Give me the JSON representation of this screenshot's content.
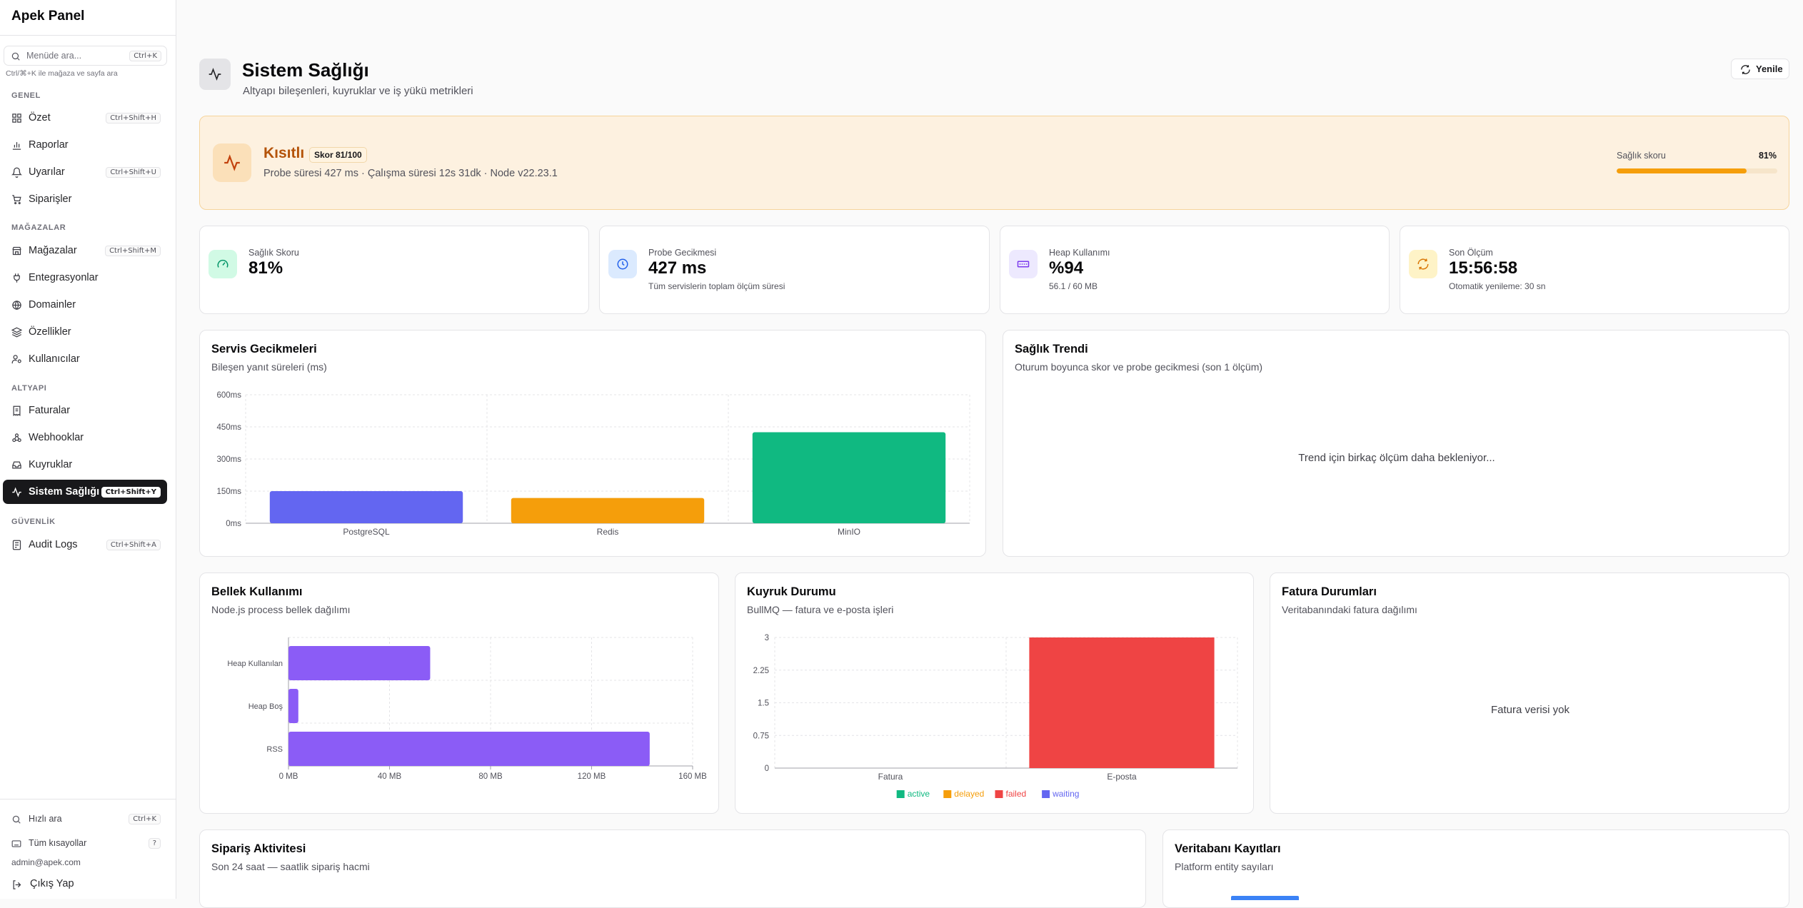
{
  "sidebar": {
    "brand": "Apek Panel",
    "search": {
      "placeholder": "Menüde ara...",
      "shortcut": "Ctrl+K",
      "hint": "Ctrl/⌘+K ile mağaza ve sayfa ara"
    },
    "groups": {
      "genel": "GENEL",
      "magazalar": "MAĞAZALAR",
      "altyapi": "ALTYAPI",
      "guvenlik": "GÜVENLİK"
    },
    "items": {
      "ozet": {
        "label": "Özet",
        "shortcut": "Ctrl+Shift+H",
        "icon": "grid-icon"
      },
      "raporlar": {
        "label": "Raporlar",
        "icon": "bar-chart-icon"
      },
      "uyarilar": {
        "label": "Uyarılar",
        "shortcut": "Ctrl+Shift+U",
        "icon": "bell-icon"
      },
      "siparisler": {
        "label": "Siparişler",
        "icon": "cart-icon"
      },
      "magazalar": {
        "label": "Mağazalar",
        "shortcut": "Ctrl+Shift+M",
        "icon": "store-icon"
      },
      "entegrasyonlar": {
        "label": "Entegrasyonlar",
        "icon": "plug-icon"
      },
      "domainler": {
        "label": "Domainler",
        "icon": "globe-icon"
      },
      "ozellikler": {
        "label": "Özellikler",
        "icon": "layers-icon"
      },
      "kullanicilar": {
        "label": "Kullanıcılar",
        "icon": "user-key-icon"
      },
      "faturalar": {
        "label": "Faturalar",
        "icon": "receipt-icon"
      },
      "webhooklar": {
        "label": "Webhooklar",
        "icon": "webhook-icon"
      },
      "kuyruklar": {
        "label": "Kuyruklar",
        "icon": "inbox-icon"
      },
      "sistem_sagligi": {
        "label": "Sistem Sağlığı",
        "shortcut": "Ctrl+Shift+Y",
        "icon": "activity-icon"
      },
      "audit_logs": {
        "label": "Audit Logs",
        "shortcut": "Ctrl+Shift+A",
        "icon": "log-icon"
      }
    },
    "footer": {
      "quick_search": {
        "label": "Hızlı ara",
        "shortcut": "Ctrl+K"
      },
      "shortcuts": {
        "label": "Tüm kısayollar",
        "shortcut": "?"
      },
      "email": "admin@apek.com",
      "logout": "Çıkış Yap"
    }
  },
  "header": {
    "title": "Sistem Sağlığı",
    "subtitle": "Altyapı bileşenleri, kuyruklar ve iş yükü metrikleri",
    "refresh_label": "Yenile"
  },
  "banner": {
    "status": "Kısıtlı",
    "score_badge": "Skor 81/100",
    "meta": "Probe süresi 427 ms · Çalışma süresi 12s 31dk · Node v22.23.1",
    "health_label": "Sağlık skoru",
    "health_value": "81%",
    "health_fraction": 0.81,
    "accent": "#f59e0b"
  },
  "stats": [
    {
      "label": "Sağlık Skoru",
      "value": "81%",
      "sub": "",
      "icon": "gauge-icon",
      "color": "#10b981"
    },
    {
      "label": "Probe Gecikmesi",
      "value": "427 ms",
      "sub": "Tüm servislerin toplam ölçüm süresi",
      "icon": "clock-icon",
      "color": "#3b82f6"
    },
    {
      "label": "Heap Kullanımı",
      "value": "%94",
      "sub": "56.1 / 60 MB",
      "icon": "memory-icon",
      "color": "#8b5cf6"
    },
    {
      "label": "Son Ölçüm",
      "value": "15:56:58",
      "sub": "Otomatik yenileme: 30 sn",
      "icon": "refresh-icon",
      "color": "#f59e0b"
    }
  ],
  "cards": {
    "latency": {
      "title": "Servis Gecikmeleri",
      "subtitle": "Bileşen yanıt süreleri (ms)"
    },
    "trend": {
      "title": "Sağlık Trendi",
      "subtitle": "Oturum boyunca skor ve probe gecikmesi (son 1 ölçüm)",
      "empty": "Trend için birkaç ölçüm daha bekleniyor..."
    },
    "memory": {
      "title": "Bellek Kullanımı",
      "subtitle": "Node.js process bellek dağılımı"
    },
    "queue": {
      "title": "Kuyruk Durumu",
      "subtitle": "BullMQ — fatura ve e-posta işleri"
    },
    "invoices": {
      "title": "Fatura Durumları",
      "subtitle": "Veritabanındaki fatura dağılımı",
      "empty": "Fatura verisi yok"
    },
    "orders": {
      "title": "Sipariş Aktivitesi",
      "subtitle": "Son 24 saat — saatlik sipariş hacmi"
    },
    "db": {
      "title": "Veritabanı Kayıtları",
      "subtitle": "Platform entity sayıları"
    }
  },
  "chart_data": [
    {
      "id": "latency",
      "type": "bar",
      "categories": [
        "PostgreSQL",
        "Redis",
        "MinIO"
      ],
      "values": [
        150,
        118,
        425
      ],
      "colors": [
        "#6366f1",
        "#f59e0b",
        "#10b981"
      ],
      "ylim": [
        0,
        600
      ],
      "yticks": [
        "0ms",
        "150ms",
        "300ms",
        "450ms",
        "600ms"
      ]
    },
    {
      "id": "memory",
      "type": "bar",
      "orientation": "horizontal",
      "categories": [
        "Heap Kullanılan",
        "Heap Boş",
        "RSS"
      ],
      "values": [
        56.1,
        3.9,
        143
      ],
      "color": "#8b5cf6",
      "xlim": [
        0,
        160
      ],
      "xticks": [
        "0 MB",
        "40 MB",
        "80 MB",
        "120 MB",
        "160 MB"
      ]
    },
    {
      "id": "queue",
      "type": "bar",
      "stacked": true,
      "categories": [
        "Fatura",
        "E-posta"
      ],
      "series": [
        {
          "name": "active",
          "values": [
            0,
            0
          ],
          "color": "#10b981"
        },
        {
          "name": "delayed",
          "values": [
            0,
            0
          ],
          "color": "#f59e0b"
        },
        {
          "name": "failed",
          "values": [
            0,
            3
          ],
          "color": "#ef4444"
        },
        {
          "name": "waiting",
          "values": [
            0,
            0
          ],
          "color": "#6366f1"
        }
      ],
      "ylim": [
        0,
        3
      ],
      "yticks": [
        "0",
        "0.75",
        "1.5",
        "2.25",
        "3"
      ]
    }
  ]
}
